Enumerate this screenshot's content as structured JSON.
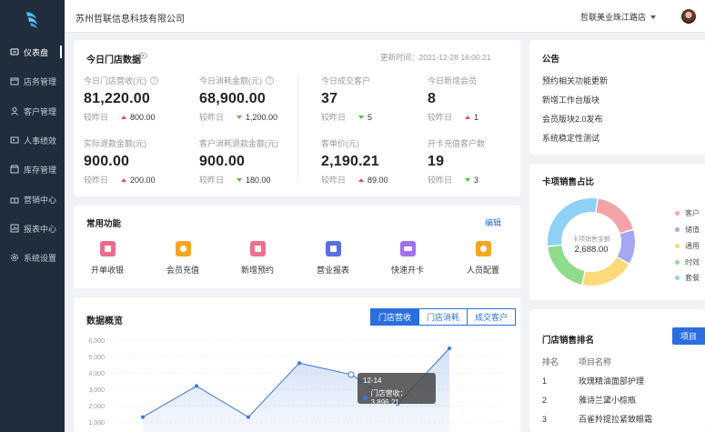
{
  "company": "苏州哲联信息科技有限公司",
  "store": "哲联美业珠江路店",
  "colors": {
    "primary": "#2b6fde",
    "sidebar": "#1f2d3d",
    "up": "#f5475f",
    "down": "#4fbf3f"
  },
  "sidebar": {
    "items": [
      {
        "label": "仪表盘",
        "icon": "dashboard-icon"
      },
      {
        "label": "店务管理",
        "icon": "store-icon"
      },
      {
        "label": "客户管理",
        "icon": "user-icon"
      },
      {
        "label": "人事绩效",
        "icon": "id-card-icon"
      },
      {
        "label": "库存管理",
        "icon": "inventory-icon"
      },
      {
        "label": "营销中心",
        "icon": "gift-icon"
      },
      {
        "label": "报表中心",
        "icon": "report-icon"
      },
      {
        "label": "系统设置",
        "icon": "gear-icon"
      }
    ]
  },
  "today": {
    "title": "今日门店数据",
    "updated": "更新时间：2021-12-28 16:00:21",
    "compare_label": "较昨日",
    "stats": [
      {
        "label": "今日门店营收(元)",
        "value": "81,220.00",
        "compare": "800.00",
        "trend": "up",
        "help": true
      },
      {
        "label": "今日消耗金额(元)",
        "value": "68,900.00",
        "compare": "1,200.00",
        "trend": "down",
        "help": true
      },
      {
        "label": "今日成交客户",
        "value": "37",
        "compare": "5",
        "trend": "down",
        "help": false
      },
      {
        "label": "今日新增会员",
        "value": "8",
        "compare": "1",
        "trend": "up",
        "help": false
      },
      {
        "label": "实际退款金额(元)",
        "value": "900.00",
        "compare": "200.00",
        "trend": "up",
        "help": false
      },
      {
        "label": "客户消耗退款金额(元)",
        "value": "900.00",
        "compare": "180.00",
        "trend": "down",
        "help": false
      },
      {
        "label": "客单价(元)",
        "value": "2,190.21",
        "compare": "89.00",
        "trend": "up",
        "help": false
      },
      {
        "label": "开卡充值客户数",
        "value": "19",
        "compare": "3",
        "trend": "down",
        "help": false
      }
    ]
  },
  "functions": {
    "title": "常用功能",
    "edit": "编辑",
    "items": [
      {
        "label": "开单收银",
        "color": "#f06a8c"
      },
      {
        "label": "会员充值",
        "color": "#f5a623"
      },
      {
        "label": "新增预约",
        "color": "#ef6f8f"
      },
      {
        "label": "营业报表",
        "color": "#5b6ee6"
      },
      {
        "label": "快速开卡",
        "color": "#a26ff0"
      },
      {
        "label": "人员配置",
        "color": "#f5a623"
      }
    ]
  },
  "notice": {
    "title": "公告",
    "items": [
      "预约相关功能更新",
      "新增工作台版块",
      "会员版块2.0发布",
      "系统稳定性测试"
    ]
  },
  "card_share": {
    "title": "卡项销售占比",
    "center_label": "卡项销售金额",
    "center_value": "2,688.00",
    "legend": [
      "客户",
      "储值",
      "通用",
      "时效",
      "套餐"
    ]
  },
  "overview": {
    "title": "数据概览",
    "tabs": [
      "门店营收",
      "门店消耗",
      "成交客户"
    ],
    "tooltip_date": "12-14",
    "tooltip_label": "门店营收：3,896.21"
  },
  "ranking": {
    "title": "门店销售排名",
    "button": "项目",
    "header_no": "排名",
    "header_name": "项目名称",
    "rows": [
      {
        "no": "1",
        "name": "玫瑰精油面部护理"
      },
      {
        "no": "2",
        "name": "雅诗兰黛小棕瓶"
      },
      {
        "no": "3",
        "name": "百雀羚提拉紧致眼霜"
      }
    ]
  },
  "chart_data": [
    {
      "type": "area",
      "yticks": [
        "6,000",
        "5,000",
        "4,000",
        "3,000",
        "2,000",
        "1,000"
      ],
      "ylim": [
        1000,
        6000
      ],
      "grid": true,
      "series": [
        {
          "values": [
            1300,
            3200,
            1300,
            4600,
            3896.21,
            2100,
            5500
          ]
        }
      ]
    },
    {
      "type": "pie",
      "center_label": "卡项销售金额",
      "center_value": "2,688.00",
      "categories": [
        "客户",
        "储值",
        "通用",
        "时效",
        "套餐"
      ],
      "values": [
        18,
        13,
        20,
        20,
        29
      ],
      "colors": [
        "#f4a3a8",
        "#a3a8f0",
        "#fdd97a",
        "#8fdc8b",
        "#8fd0f6"
      ]
    }
  ]
}
